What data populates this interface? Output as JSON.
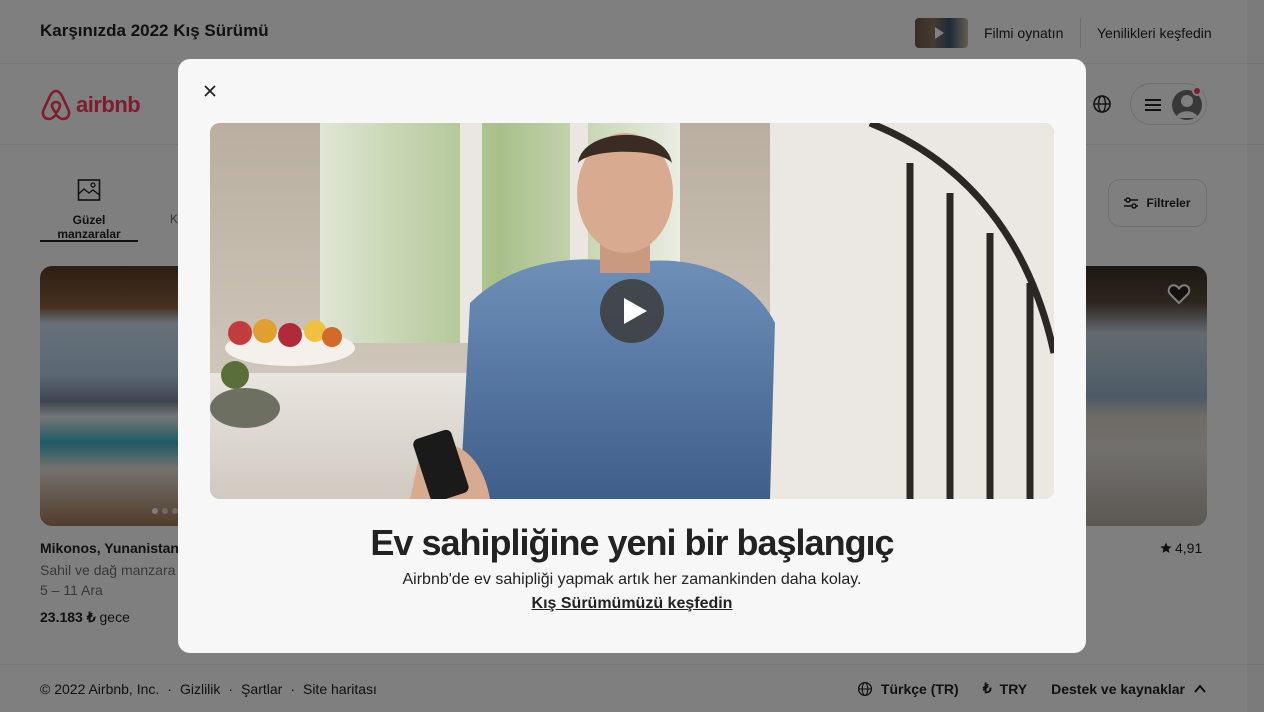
{
  "banner": {
    "title": "Karşınızda 2022 Kış Sürümü",
    "play_label": "Filmi oynatın",
    "explore_label": "Yenilikleri keşfedin"
  },
  "header": {
    "logo_text": "airbnb",
    "brand_color": "#ff385c"
  },
  "categories": {
    "active_label": "Güzel manzaralar",
    "next_label_partial": "K",
    "filter_label": "Filtreler"
  },
  "listing": {
    "title": "Mikonos, Yunanistan",
    "subtitle": "Sahil ve dağ manzara",
    "dates": "5 – 11 Ara",
    "price": "23.183 ₺",
    "price_unit": "gece",
    "rating": "4,91"
  },
  "footer": {
    "copyright": "© 2022 Airbnb, Inc.",
    "links": [
      "Gizlilik",
      "Şartlar",
      "Site haritası"
    ],
    "separator": "·",
    "language": "Türkçe (TR)",
    "currency_symbol": "₺",
    "currency": "TRY",
    "support": "Destek ve kaynaklar"
  },
  "modal": {
    "title": "Ev sahipliğine yeni bir başlangıç",
    "subtitle": "Airbnb'de ev sahipliği yapmak artık her zamankinden daha kolay.",
    "link": "Kış Sürümümüzü keşfedin"
  }
}
